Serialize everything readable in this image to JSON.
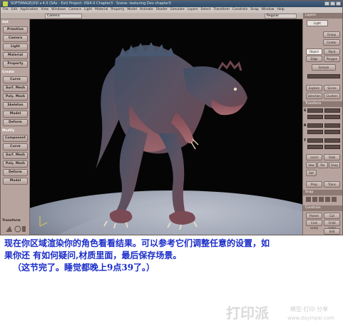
{
  "window": {
    "title": "SOFTIMAGE|XSI v.4.0 (SAv - Ext) Project: XSI4.0 Chapter3 · Scene: texturing Dev chapter3"
  },
  "menubar": [
    "File",
    "Edit",
    "Application",
    "View",
    "Windows",
    "Camera",
    "Light",
    "Material",
    "Property",
    "Model",
    "Animate",
    "Shader",
    "Simulate",
    "Layers",
    "Select",
    "Transform",
    "Constrain",
    "Snap",
    "Window",
    "Help"
  ],
  "toolbar": {
    "view_mode": "Camera",
    "right_mode": "Regular"
  },
  "left_panel": {
    "sections": [
      {
        "label": "Get",
        "buttons": [
          "Primitive",
          "Camera",
          "Light",
          "Material",
          "Property"
        ]
      },
      {
        "label": "Create",
        "buttons": [
          "Curve",
          "Surf. Mesh",
          "Poly. Mesh",
          "Skeleton",
          "Model",
          "Deform"
        ]
      },
      {
        "label": "Modify",
        "buttons": [
          "Component",
          "Curve",
          "Surf. Mesh",
          "Poly. Mesh",
          "Deform",
          "Model"
        ]
      }
    ],
    "footer": "Transform"
  },
  "right_panel": {
    "header1": "Layers",
    "layer_field": "Light",
    "buttons_a": [
      "Group",
      "Center"
    ],
    "tabs": [
      "Object",
      "Point"
    ],
    "tabs2": [
      "Edge",
      "Polygon"
    ],
    "sample": "Sample",
    "explore": [
      "Explore",
      "Scene"
    ],
    "selection": [
      "Selection",
      "Clusters"
    ],
    "header2": "Transform",
    "transform_labels": [
      "S",
      "R",
      "T"
    ],
    "bottom_buttons": [
      "Local",
      "Glob",
      "Vew",
      "Par",
      "Snap",
      "Ref",
      "Prop",
      "Trans"
    ],
    "snap_header": "Snap",
    "constrain_header": "Constrain",
    "constrain_buttons": [
      "Parent",
      "Cut",
      "Cnst comp",
      "Child comp"
    ],
    "edit_button": "Edit"
  },
  "caption": {
    "line1": "现在你区域渲染你的角色看看结果。可以参考它们调整任意的设置，如",
    "line2": "果你还 有如何疑问,材质里面，最后保存场景。",
    "line3": "（这节完了。睡觉都晚上9点39了。）"
  },
  "watermark": {
    "brand": "打印派",
    "tag_line1": "模型·打印·分享",
    "tag_line2": "www.dayinpai.com"
  },
  "colors": {
    "caption": "#1a2cc9",
    "panel": "#b8a49e",
    "viewport": "#050505"
  }
}
